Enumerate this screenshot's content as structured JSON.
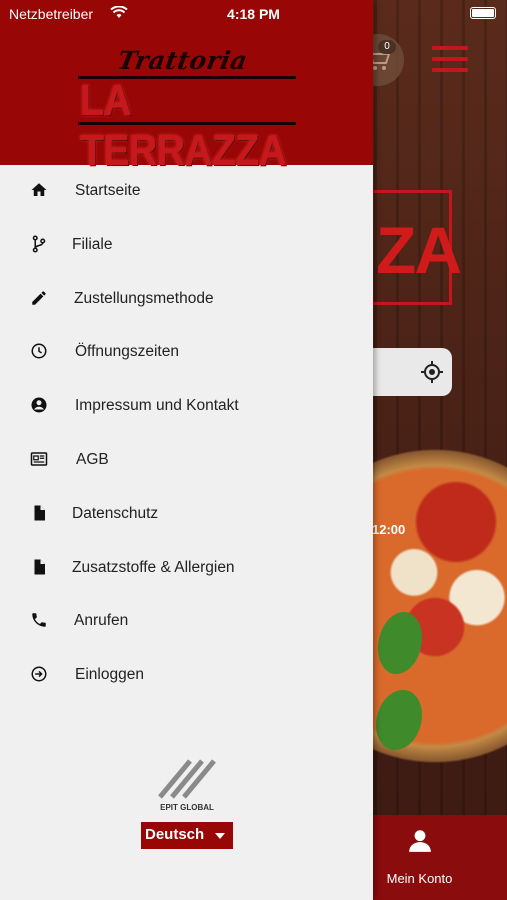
{
  "status_bar": {
    "carrier": "Netzbetreiber",
    "time": "4:18 PM"
  },
  "header": {
    "logo_script": "Trattoria",
    "logo_main": "LA TERRAZZA"
  },
  "menu": {
    "items": [
      {
        "label": "Startseite",
        "icon": "home-icon"
      },
      {
        "label": "Filiale",
        "icon": "branch-icon"
      },
      {
        "label": "Zustellungsmethode",
        "icon": "pencil-icon"
      },
      {
        "label": "Öffnungszeiten",
        "icon": "clock-icon"
      },
      {
        "label": "Impressum und Kontakt",
        "icon": "account-circle-icon"
      },
      {
        "label": "AGB",
        "icon": "newspaper-icon"
      },
      {
        "label": "Datenschutz",
        "icon": "document-icon"
      },
      {
        "label": "Zusatzstoffe & Allergien",
        "icon": "document-icon"
      },
      {
        "label": "Anrufen",
        "icon": "phone-icon"
      },
      {
        "label": "Einloggen",
        "icon": "login-icon"
      }
    ]
  },
  "footer": {
    "brand": "EPIT GLOBAL",
    "language": "Deutsch"
  },
  "background": {
    "cart_count": "0",
    "logo_fragment": "ZA",
    "time_label": "12:00",
    "bottom_nav_label": "Mein Konto"
  },
  "colors": {
    "brand_red": "#980606",
    "drawer_bg": "#f0f0f0",
    "text": "#222222"
  }
}
